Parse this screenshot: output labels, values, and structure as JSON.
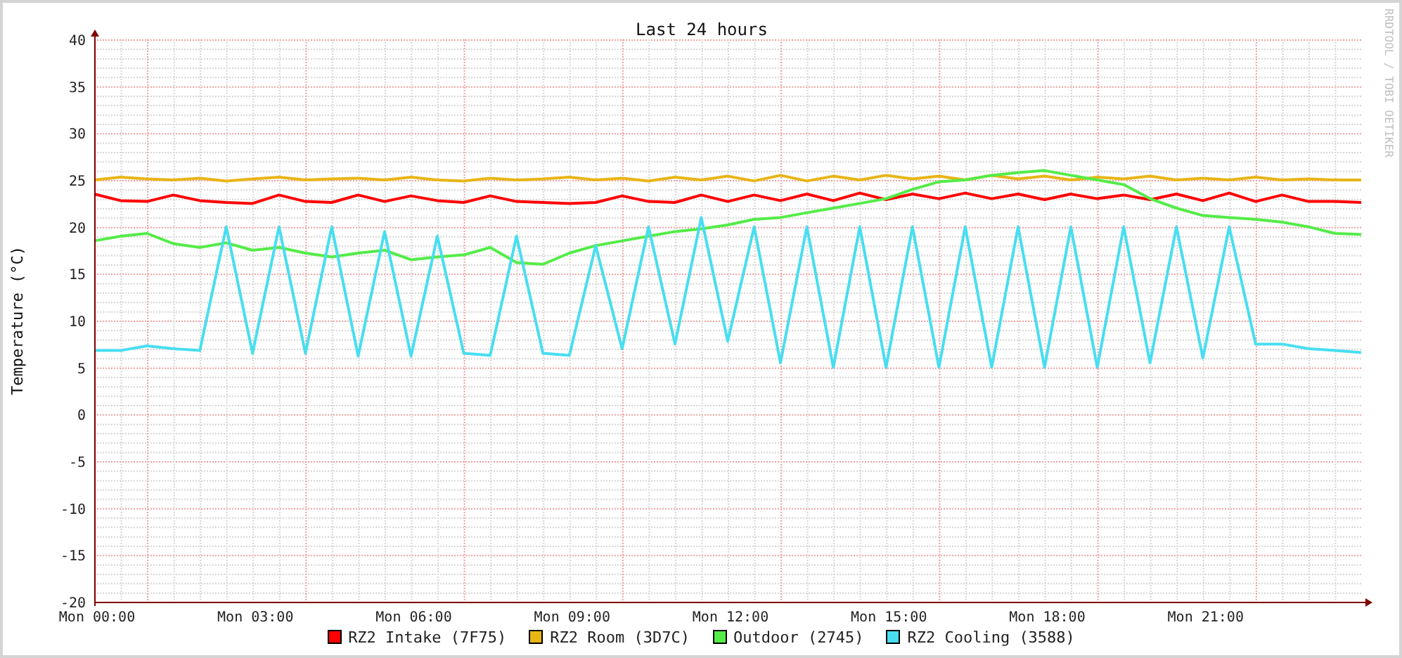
{
  "credit": "RRDTOOL / TOBI OETIKER",
  "chart_data": {
    "type": "line",
    "title": "Last 24 hours",
    "ylabel": "Temperature (°C)",
    "categories": [
      "Mon 00:00",
      null,
      null,
      null,
      null,
      null,
      "Mon 03:00",
      null,
      null,
      null,
      null,
      null,
      "Mon 06:00",
      null,
      null,
      null,
      null,
      null,
      "Mon 09:00",
      null,
      null,
      null,
      null,
      null,
      "Mon 12:00",
      null,
      null,
      null,
      null,
      null,
      "Mon 15:00",
      null,
      null,
      null,
      null,
      null,
      "Mon 18:00",
      null,
      null,
      null,
      null,
      null,
      "Mon 21:00",
      null,
      null,
      null,
      null,
      null,
      null
    ],
    "ylim": [
      -20,
      40
    ],
    "grid": true,
    "yticks": [
      {
        "value": 40,
        "label": "40"
      },
      {
        "value": 35,
        "label": "35"
      },
      {
        "value": 30,
        "label": "30"
      },
      {
        "value": 25,
        "label": "25"
      },
      {
        "value": 20,
        "label": "20"
      },
      {
        "value": 15,
        "label": "15"
      },
      {
        "value": 10,
        "label": "10"
      },
      {
        "value": 5,
        "label": "5"
      },
      {
        "value": 0,
        "label": "0"
      },
      {
        "value": -5,
        "label": "-5"
      },
      {
        "value": -10,
        "label": "-10"
      },
      {
        "value": -15,
        "label": "-15"
      },
      {
        "value": -20,
        "label": "-20"
      }
    ],
    "series": [
      {
        "name": "RZ2 Intake (7F75)",
        "color": "#ff0000",
        "values": [
          23.5,
          22.8,
          22.7,
          23.4,
          22.8,
          22.6,
          22.5,
          23.4,
          22.7,
          22.6,
          23.4,
          22.7,
          23.3,
          22.8,
          22.6,
          23.3,
          22.7,
          22.6,
          22.5,
          22.6,
          23.3,
          22.7,
          22.6,
          23.4,
          22.7,
          23.4,
          22.8,
          23.5,
          22.8,
          23.6,
          22.9,
          23.5,
          23.0,
          23.6,
          23.0,
          23.5,
          22.9,
          23.5,
          23.0,
          23.4,
          22.9,
          23.5,
          22.8,
          23.6,
          22.7,
          23.4,
          22.7,
          22.7,
          22.6
        ]
      },
      {
        "name": "RZ2 Room (3D7C)",
        "color": "#e8b517",
        "values": [
          25.0,
          25.3,
          25.1,
          25.0,
          25.2,
          24.9,
          25.1,
          25.3,
          25.0,
          25.1,
          25.2,
          25.0,
          25.3,
          25.0,
          24.9,
          25.2,
          25.0,
          25.1,
          25.3,
          25.0,
          25.2,
          24.9,
          25.3,
          25.0,
          25.4,
          24.9,
          25.5,
          24.9,
          25.4,
          25.0,
          25.5,
          25.1,
          25.4,
          25.0,
          25.5,
          25.1,
          25.4,
          25.0,
          25.3,
          25.1,
          25.4,
          25.0,
          25.2,
          25.0,
          25.3,
          25.0,
          25.1,
          25.0,
          25.0
        ]
      },
      {
        "name": "Outdoor (2745)",
        "color": "#54ec48",
        "values": [
          18.5,
          19.0,
          19.3,
          18.2,
          17.8,
          18.3,
          17.5,
          17.8,
          17.2,
          16.8,
          17.2,
          17.5,
          16.5,
          16.8,
          17.0,
          17.8,
          16.2,
          16.0,
          17.2,
          18.0,
          18.5,
          19.0,
          19.5,
          19.8,
          20.2,
          20.8,
          21.0,
          21.5,
          22.0,
          22.5,
          23.0,
          24.0,
          24.8,
          25.0,
          25.5,
          25.8,
          26.0,
          25.5,
          25.0,
          24.5,
          23.0,
          22.0,
          21.2,
          21.0,
          20.8,
          20.5,
          20.0,
          19.3,
          19.2
        ]
      },
      {
        "name": "RZ2 Cooling (3588)",
        "color": "#48def0",
        "values": [
          6.8,
          6.8,
          7.3,
          7.0,
          6.8,
          20,
          6.5,
          20,
          6.5,
          20,
          6.2,
          19.5,
          6.2,
          19,
          6.5,
          6.3,
          19,
          6.5,
          6.3,
          18,
          7.0,
          20,
          7.5,
          21,
          7.8,
          20,
          5.5,
          20,
          5.0,
          20,
          5.0,
          20,
          5.0,
          20,
          5.0,
          20,
          5.0,
          20,
          5.0,
          20,
          5.5,
          20,
          6.0,
          20,
          7.5,
          7.5,
          7.0,
          6.8,
          6.6
        ]
      }
    ]
  }
}
